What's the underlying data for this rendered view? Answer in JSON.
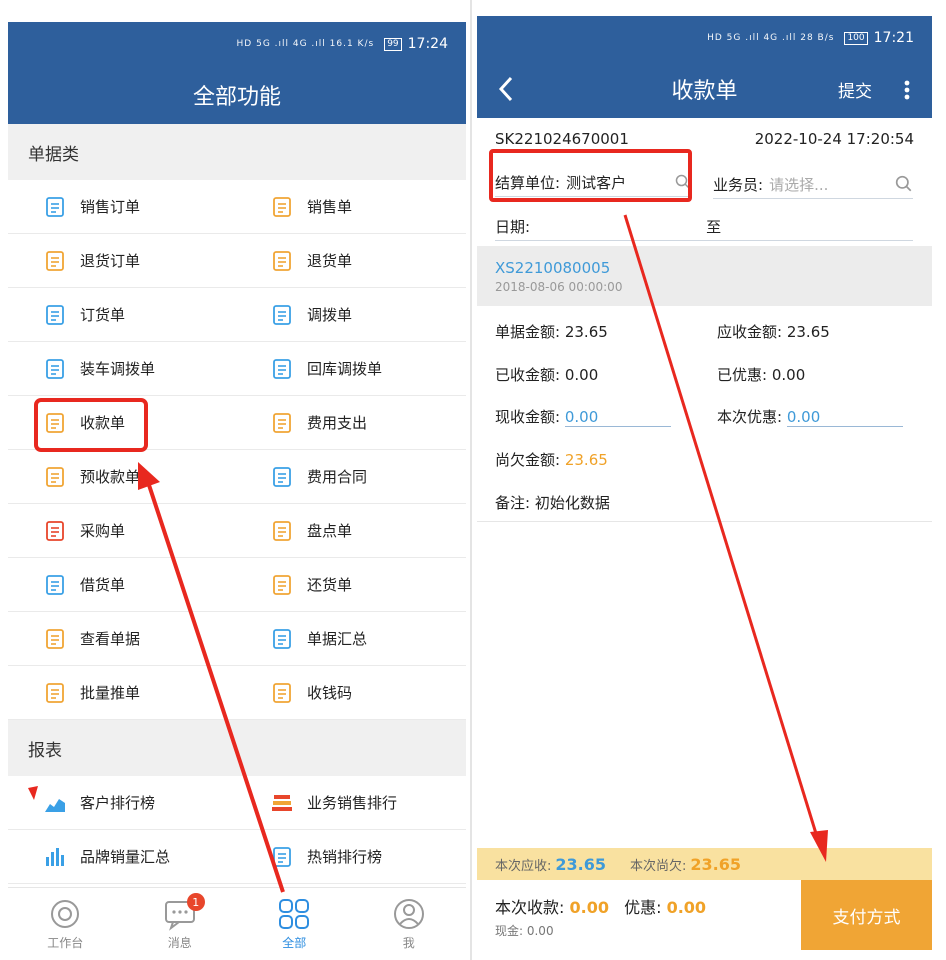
{
  "left": {
    "status": {
      "signal": "HD 5G .ıll 4G .ıll 16.1 K/s",
      "battery": "99",
      "time": "17:24"
    },
    "title": "全部功能",
    "sections": [
      {
        "name": "单据类",
        "items": [
          {
            "label": "销售订单",
            "icon": "sales-order-icon",
            "color": "#3aa0e6"
          },
          {
            "label": "销售单",
            "icon": "sales-bill-icon",
            "color": "#f0a535"
          },
          {
            "label": "退货订单",
            "icon": "return-order-icon",
            "color": "#f0a535"
          },
          {
            "label": "退货单",
            "icon": "return-bill-icon",
            "color": "#f0a535"
          },
          {
            "label": "订货单",
            "icon": "purchase-order-icon",
            "color": "#3aa0e6"
          },
          {
            "label": "调拨单",
            "icon": "transfer-icon",
            "color": "#3aa0e6"
          },
          {
            "label": "装车调拨单",
            "icon": "truck-transfer-icon",
            "color": "#3aa0e6"
          },
          {
            "label": "回库调拨单",
            "icon": "return-transfer-icon",
            "color": "#3aa0e6"
          },
          {
            "label": "收款单",
            "icon": "receipt-icon",
            "color": "#f0a535"
          },
          {
            "label": "费用支出",
            "icon": "expense-icon",
            "color": "#f0a535"
          },
          {
            "label": "预收款单",
            "icon": "prepay-icon",
            "color": "#f0a535"
          },
          {
            "label": "费用合同",
            "icon": "contract-icon",
            "color": "#3aa0e6"
          },
          {
            "label": "采购单",
            "icon": "procurement-icon",
            "color": "#e8462b"
          },
          {
            "label": "盘点单",
            "icon": "stocktake-icon",
            "color": "#f0a535"
          },
          {
            "label": "借货单",
            "icon": "borrow-icon",
            "color": "#3aa0e6"
          },
          {
            "label": "还货单",
            "icon": "giveback-icon",
            "color": "#f0a535"
          },
          {
            "label": "查看单据",
            "icon": "view-doc-icon",
            "color": "#f0a535"
          },
          {
            "label": "单据汇总",
            "icon": "doc-summary-icon",
            "color": "#3aa0e6"
          },
          {
            "label": "批量推单",
            "icon": "batch-push-icon",
            "color": "#f0a535"
          },
          {
            "label": "收钱码",
            "icon": "qr-pay-icon",
            "color": "#f0a535"
          }
        ]
      },
      {
        "name": "报表",
        "items": [
          {
            "label": "客户排行榜",
            "icon": "area-chart-icon",
            "color": "#3aa0e6"
          },
          {
            "label": "业务销售排行",
            "icon": "ranking-icon",
            "color": "#e8462b"
          },
          {
            "label": "品牌销量汇总",
            "icon": "bar-chart-icon",
            "color": "#3aa0e6"
          },
          {
            "label": "热销排行榜",
            "icon": "hot-list-icon",
            "color": "#3aa0e6"
          }
        ]
      }
    ],
    "tabs": [
      {
        "label": "工作台",
        "icon": "workbench-icon"
      },
      {
        "label": "消息",
        "icon": "message-icon",
        "badge": "1"
      },
      {
        "label": "全部",
        "icon": "all-grid-icon"
      },
      {
        "label": "我",
        "icon": "profile-icon"
      }
    ]
  },
  "right": {
    "status": {
      "signal": "HD 5G .ıll 4G .ıll 28 B/s",
      "battery": "100",
      "time": "17:21"
    },
    "title": "收款单",
    "submit": "提交",
    "doc_no": "SK221024670001",
    "doc_time": "2022-10-24 17:20:54",
    "settle_label": "结算单位:",
    "settle_value": "测试客户",
    "salesman_label": "业务员:",
    "salesman_placeholder": "请选择...",
    "date_label": "日期:",
    "date_to": "至",
    "bill_no": "XS2210080005",
    "bill_time": "2018-08-06 00:00:00",
    "amounts": {
      "bill_amount_label": "单据金额:",
      "bill_amount": "23.65",
      "receivable_label": "应收金额:",
      "receivable": "23.65",
      "received_label": "已收金额:",
      "received": "0.00",
      "discounted_label": "已优惠:",
      "discounted": "0.00",
      "current_label": "现收金额:",
      "current": "0.00",
      "this_discount_label": "本次优惠:",
      "this_discount": "0.00",
      "owed_label": "尚欠金额:",
      "owed": "23.65",
      "note_label": "备注:",
      "note": "初始化数据"
    },
    "summary": {
      "due_label": "本次应收:",
      "due": "23.65",
      "owe_label": "本次尚欠:",
      "owe": "23.65"
    },
    "footer": {
      "collect_label": "本次收款:",
      "collect": "0.00",
      "discount_label": "优惠:",
      "discount": "0.00",
      "cash": "现金: 0.00",
      "pay_button": "支付方式"
    }
  },
  "colors": {
    "primary": "#2e5f9c",
    "accent_blue": "#3aa0e6",
    "accent_orange": "#f0a535",
    "highlight_red": "#e8281f"
  }
}
